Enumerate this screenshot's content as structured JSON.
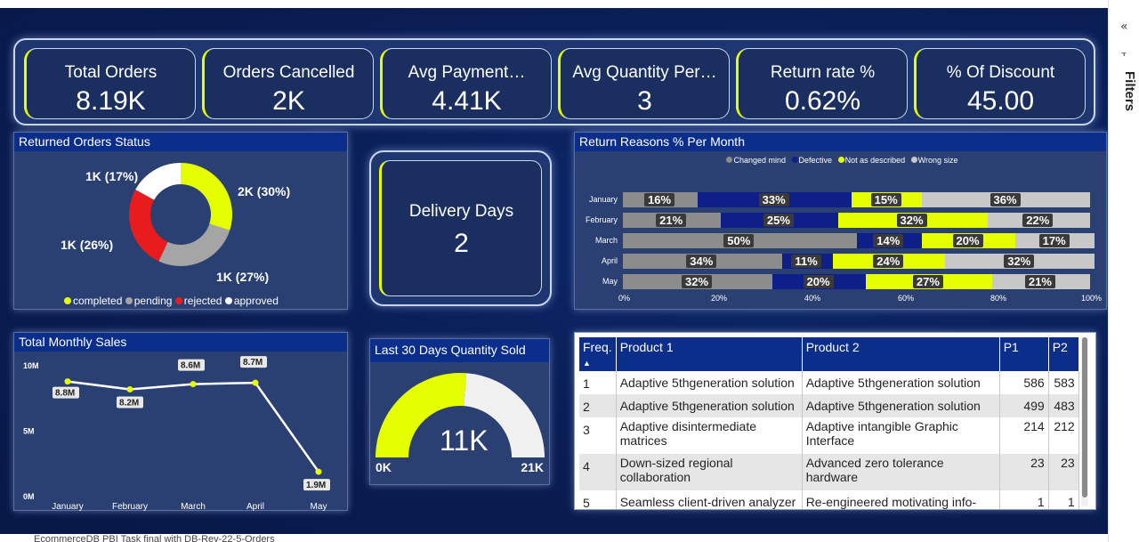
{
  "footer": "EcommerceDB PBI Task final with DB-Rev-22-5-Orders",
  "filters_pane": {
    "label": "Filters",
    "collapse_glyph": "«",
    "icon_glyph": "⫟"
  },
  "kpis": [
    {
      "title": "Total Orders",
      "value": "8.19K"
    },
    {
      "title": "Orders Cancelled",
      "value": "2K"
    },
    {
      "title": "Avg Payment…",
      "value": "4.41K"
    },
    {
      "title": "Avg Quantity Per…",
      "value": "3"
    },
    {
      "title": "Return rate %",
      "value": "0.62%"
    },
    {
      "title": "% Of Discount",
      "value": "45.00"
    }
  ],
  "returned_status": {
    "title": "Returned Orders Status",
    "labels": [
      "2K (30%)",
      "1K (27%)",
      "1K (26%)",
      "1K (17%)"
    ],
    "legend": [
      "completed",
      "pending",
      "rejected",
      "approved"
    ]
  },
  "delivery": {
    "title": "Delivery Days",
    "value": "2"
  },
  "return_reasons": {
    "title": "Return Reasons % Per Month",
    "legend": [
      "Changed mind",
      "Defective",
      "Not as described",
      "Wrong size"
    ],
    "axis": [
      "0%",
      "20%",
      "40%",
      "60%",
      "80%",
      "100%"
    ]
  },
  "monthly_sales": {
    "title": "Total Monthly Sales"
  },
  "gauge": {
    "title": "Last 30 Days Quantity Sold",
    "value": "11K",
    "min": "0K",
    "max": "21K",
    "fill_fraction": 0.52
  },
  "table": {
    "headers": [
      "Freq.",
      "Product 1",
      "Product 2",
      "P1",
      "P2"
    ],
    "rows": [
      {
        "freq": "1",
        "p1": "Adaptive 5thgeneration solution",
        "p2": "Adaptive 5thgeneration solution",
        "n1": "586",
        "n2": "583"
      },
      {
        "freq": "2",
        "p1": "Adaptive 5thgeneration solution",
        "p2": "Adaptive 5thgeneration solution",
        "n1": "499",
        "n2": "483"
      },
      {
        "freq": "3",
        "p1": "Adaptive disintermediate matrices",
        "p2": "Adaptive intangible Graphic Interface",
        "n1": "214",
        "n2": "212"
      },
      {
        "freq": "4",
        "p1": "Down-sized regional collaboration",
        "p2": "Advanced zero tolerance hardware",
        "n1": "23",
        "n2": "23"
      },
      {
        "freq": "5",
        "p1": "Seamless client-driven analyzer",
        "p2": "Re-engineered motivating info-",
        "n1": "1",
        "n2": "1"
      }
    ]
  },
  "colors": {
    "accent": "#e6ff00",
    "header": "#0b2e8a",
    "grey": "#a5a5a5",
    "defective": "#0e1f8a",
    "wrong_size": "#c8c8c8",
    "changed_mind": "#8c8c8c",
    "rejected": "#e81c1c"
  },
  "chart_data": [
    {
      "type": "pie",
      "title": "Returned Orders Status",
      "categories": [
        "completed",
        "pending",
        "rejected",
        "approved"
      ],
      "values": [
        30,
        27,
        26,
        17
      ],
      "value_labels": [
        "2K (30%)",
        "1K (27%)",
        "1K (26%)",
        "1K (17%)"
      ],
      "donut": true,
      "colors": [
        "#e6ff00",
        "#a5a5a5",
        "#e81c1c",
        "#ffffff"
      ],
      "legend": "bottom"
    },
    {
      "type": "bar",
      "stacked": "100%",
      "orientation": "horizontal",
      "title": "Return Reasons % Per Month",
      "categories": [
        "January",
        "February",
        "March",
        "April",
        "May"
      ],
      "series": [
        {
          "name": "Changed mind",
          "values": [
            16,
            21,
            50,
            34,
            32
          ],
          "color": "#8c8c8c"
        },
        {
          "name": "Defective",
          "values": [
            33,
            25,
            14,
            11,
            20
          ],
          "color": "#0e1f8a"
        },
        {
          "name": "Not as described",
          "values": [
            15,
            32,
            20,
            24,
            27
          ],
          "color": "#e6ff00"
        },
        {
          "name": "Wrong size",
          "values": [
            36,
            22,
            17,
            32,
            21
          ],
          "color": "#c8c8c8"
        }
      ],
      "xlim": [
        0,
        100
      ],
      "x_ticks": [
        "0%",
        "20%",
        "40%",
        "60%",
        "80%",
        "100%"
      ],
      "legend": "top"
    },
    {
      "type": "line",
      "title": "Total Monthly Sales",
      "categories": [
        "January",
        "February",
        "March",
        "April",
        "May"
      ],
      "values": [
        8.8,
        8.2,
        8.6,
        8.7,
        1.9
      ],
      "value_labels": [
        "8.8M",
        "8.2M",
        "8.6M",
        "8.7M",
        "1.9M"
      ],
      "ylim": [
        0,
        10
      ],
      "y_ticks": [
        "0M",
        "5M",
        "10M"
      ]
    },
    {
      "type": "gauge",
      "title": "Last 30 Days Quantity Sold",
      "value": 11,
      "min": 0,
      "max": 21,
      "labels": [
        "11K",
        "0K",
        "21K"
      ]
    }
  ]
}
